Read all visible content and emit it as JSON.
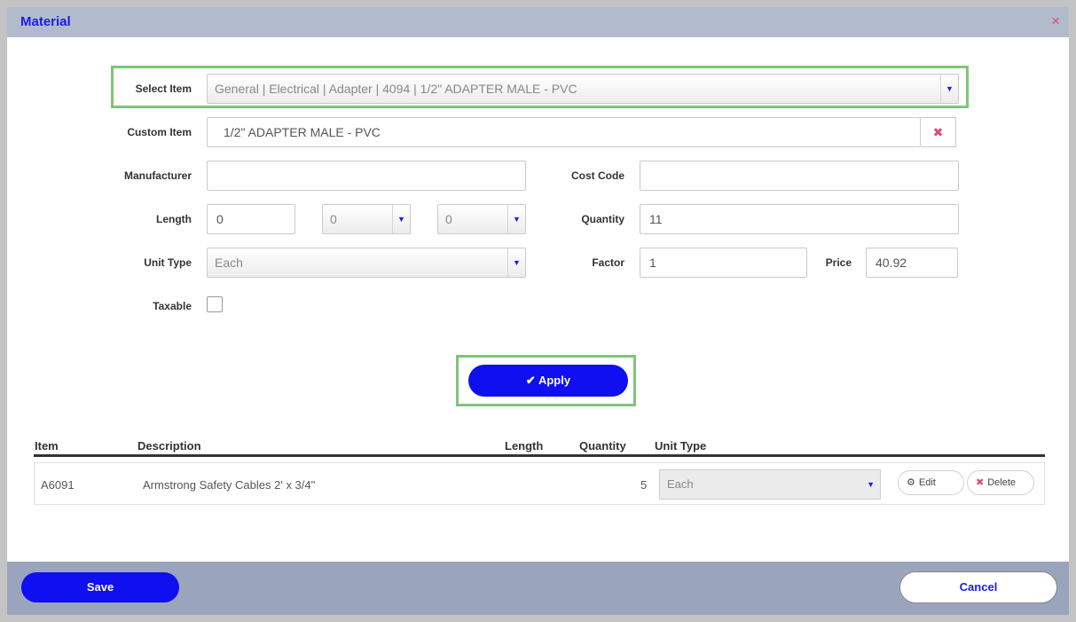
{
  "dialog": {
    "title": "Material",
    "close_icon": "×"
  },
  "form": {
    "select_item": {
      "label": "Select Item",
      "value": "General | Electrical | Adapter | 4094 | 1/2\" ADAPTER MALE - PVC"
    },
    "custom_item": {
      "label": "Custom Item",
      "value": "1/2\" ADAPTER MALE - PVC",
      "clear_icon": "✖"
    },
    "manufacturer": {
      "label": "Manufacturer",
      "value": ""
    },
    "cost_code": {
      "label": "Cost Code",
      "value": ""
    },
    "length": {
      "label": "Length",
      "feet": "0",
      "inches": "0",
      "fraction": "0"
    },
    "quantity": {
      "label": "Quantity",
      "value": "11"
    },
    "unit_type": {
      "label": "Unit Type",
      "value": "Each"
    },
    "factor": {
      "label": "Factor",
      "value": "1"
    },
    "price": {
      "label": "Price",
      "value": "40.92"
    },
    "taxable": {
      "label": "Taxable",
      "checked": false
    },
    "apply_button": {
      "label": "Apply",
      "icon": "✔"
    },
    "caret": "▼"
  },
  "table": {
    "headers": {
      "item": "Item",
      "description": "Description",
      "length": "Length",
      "quantity": "Quantity",
      "unit_type": "Unit Type"
    },
    "rows": [
      {
        "item": "A6091",
        "description": "Armstrong Safety Cables 2' x 3/4\"",
        "length": "",
        "quantity": "5",
        "unit_type": "Each",
        "edit_label": "Edit",
        "edit_icon": "⚙",
        "delete_label": "Delete",
        "delete_icon": "✖"
      }
    ]
  },
  "footer": {
    "save_label": "Save",
    "cancel_label": "Cancel"
  },
  "colors": {
    "accent": "#0f0ff0",
    "title": "#1a1aef",
    "close": "#e0457b",
    "highlight": "#7fc47a"
  }
}
